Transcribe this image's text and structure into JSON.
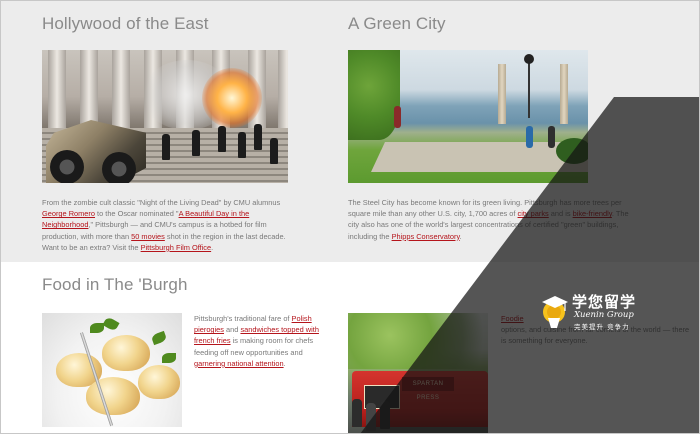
{
  "sections": {
    "hollywood": {
      "title": "Hollywood of the East",
      "text_1": "From the zombie cult classic \"Night of the Living Dead\" by CMU alumnus ",
      "link_1": "George Romero",
      "text_2": " to the Oscar nominated \"",
      "link_2": "A Beautiful Day in the Neighborhood",
      "text_3": ",\" Pittsburgh — and CMU's campus is a hotbed for film production, with more than ",
      "link_3": "50 movies",
      "text_4": " shot in the region in the last decade. Want to be an extra? Visit the ",
      "link_4": "Pittsburgh Film Office",
      "text_5": "."
    },
    "green_city": {
      "title": "A Green City",
      "text_1": "The Steel City has become known for its green living. Pittsburgh has more trees per square mile than any other U.S. city, 1,700 acres of ",
      "link_1": "city parks",
      "text_2": " and is ",
      "link_2": "bike-friendly",
      "text_3": ". The city also has one of the world's largest concentrations of certified \"green\" buildings, including the ",
      "link_3": "Phipps Conservatory",
      "text_4": "."
    },
    "food": {
      "title": "Food in The 'Burgh",
      "text_1": "Pittsburgh's traditional fare of ",
      "link_1": "Polish pierogies",
      "text_2": " and ",
      "link_2": "sandwiches topped with french fries",
      "text_3": " is making room for chefs feeding off new opportunities and ",
      "link_3": "garnering national attention",
      "text_4": ".",
      "right_link": "Foodie",
      "right_text": "options, and cuisine from far corners of the world — there is something for everyone."
    }
  },
  "images": {
    "truck_sign": "SPARTAN PRESS"
  },
  "watermark": {
    "title": "学您留学",
    "subtitle": "Xuenin Group",
    "tagline": "完美提升  竞争力"
  },
  "colors": {
    "link": "#b5141b",
    "top_background": "#ececec",
    "bottom_background": "#ffffff",
    "text": "#7a7a7a"
  }
}
